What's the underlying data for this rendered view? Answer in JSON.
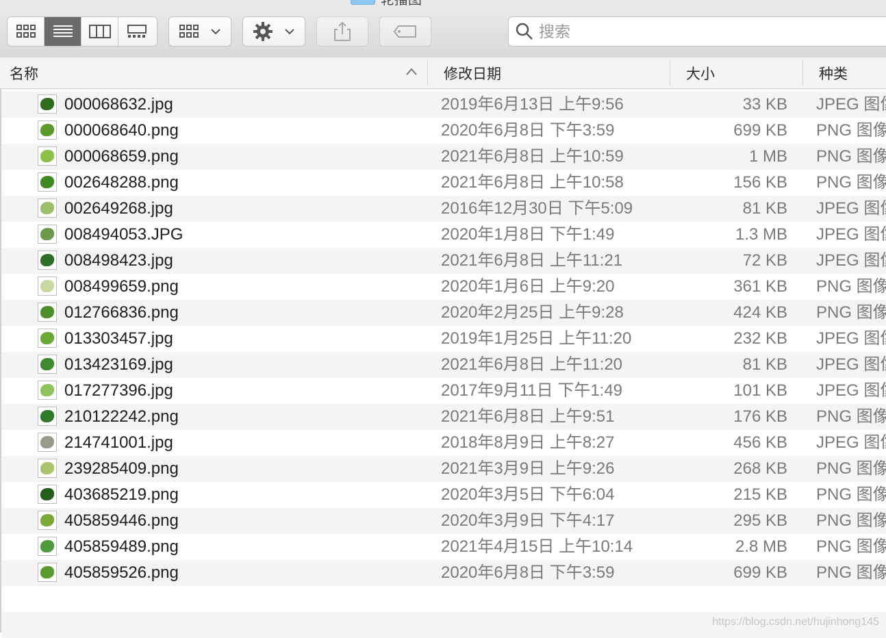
{
  "window": {
    "title": "轮播图"
  },
  "toolbar": {
    "view_buttons": [
      "icon-view",
      "list-view",
      "column-view",
      "gallery-view"
    ],
    "active_view": 1,
    "search_placeholder": "搜索"
  },
  "columns": {
    "name": "名称",
    "date": "修改日期",
    "size": "大小",
    "kind": "种类"
  },
  "files": [
    {
      "name": "000068632.jpg",
      "date": "2019年6月13日 上午9:56",
      "size": "33 KB",
      "kind": "JPEG 图像",
      "thumb": "#2f6a1d"
    },
    {
      "name": "000068640.png",
      "date": "2020年6月8日 下午3:59",
      "size": "699 KB",
      "kind": "PNG 图像",
      "thumb": "#5a9a2c"
    },
    {
      "name": "000068659.png",
      "date": "2021年6月8日 上午10:59",
      "size": "1 MB",
      "kind": "PNG 图像",
      "thumb": "#8cc04a"
    },
    {
      "name": "002648288.png",
      "date": "2021年6月8日 上午10:58",
      "size": "156 KB",
      "kind": "PNG 图像",
      "thumb": "#3f8a22"
    },
    {
      "name": "002649268.jpg",
      "date": "2016年12月30日 下午5:09",
      "size": "81 KB",
      "kind": "JPEG 图像",
      "thumb": "#9bbf6a"
    },
    {
      "name": "008494053.JPG",
      "date": "2020年1月8日 下午1:49",
      "size": "1.3 MB",
      "kind": "JPEG 图像",
      "thumb": "#6a9a4a"
    },
    {
      "name": "008498423.jpg",
      "date": "2021年6月8日 上午11:21",
      "size": "72 KB",
      "kind": "JPEG 图像",
      "thumb": "#2e6e26"
    },
    {
      "name": "008499659.png",
      "date": "2020年1月6日 上午9:20",
      "size": "361 KB",
      "kind": "PNG 图像",
      "thumb": "#c9d9a0"
    },
    {
      "name": "012766836.png",
      "date": "2020年2月25日 上午9:28",
      "size": "424 KB",
      "kind": "PNG 图像",
      "thumb": "#4c8f2a"
    },
    {
      "name": "013303457.jpg",
      "date": "2019年1月25日 上午11:20",
      "size": "232 KB",
      "kind": "JPEG 图像",
      "thumb": "#6aa83a"
    },
    {
      "name": "013423169.jpg",
      "date": "2021年6月8日 上午11:20",
      "size": "81 KB",
      "kind": "JPEG 图像",
      "thumb": "#3f8a2e"
    },
    {
      "name": "017277396.jpg",
      "date": "2017年9月11日 下午1:49",
      "size": "101 KB",
      "kind": "JPEG 图像",
      "thumb": "#8fc25a"
    },
    {
      "name": "210122242.png",
      "date": "2021年6月8日 上午9:51",
      "size": "176 KB",
      "kind": "PNG 图像",
      "thumb": "#2f7a2a"
    },
    {
      "name": "214741001.jpg",
      "date": "2018年8月9日 上午8:27",
      "size": "456 KB",
      "kind": "JPEG 图像",
      "thumb": "#9a9a8a"
    },
    {
      "name": "239285409.png",
      "date": "2021年3月9日 上午9:26",
      "size": "268 KB",
      "kind": "PNG 图像",
      "thumb": "#a9c46a"
    },
    {
      "name": "403685219.png",
      "date": "2020年3月5日 下午6:04",
      "size": "215 KB",
      "kind": "PNG 图像",
      "thumb": "#245f1c"
    },
    {
      "name": "405859446.png",
      "date": "2020年3月9日 下午4:17",
      "size": "295 KB",
      "kind": "PNG 图像",
      "thumb": "#7aa83a"
    },
    {
      "name": "405859489.png",
      "date": "2021年4月15日 上午10:14",
      "size": "2.8 MB",
      "kind": "PNG 图像",
      "thumb": "#4f9a3a"
    },
    {
      "name": "405859526.png",
      "date": "2020年6月8日 下午3:59",
      "size": "699 KB",
      "kind": "PNG 图像",
      "thumb": "#5a9a2c"
    }
  ],
  "watermark": "https://blog.csdn.net/hujinhong145"
}
